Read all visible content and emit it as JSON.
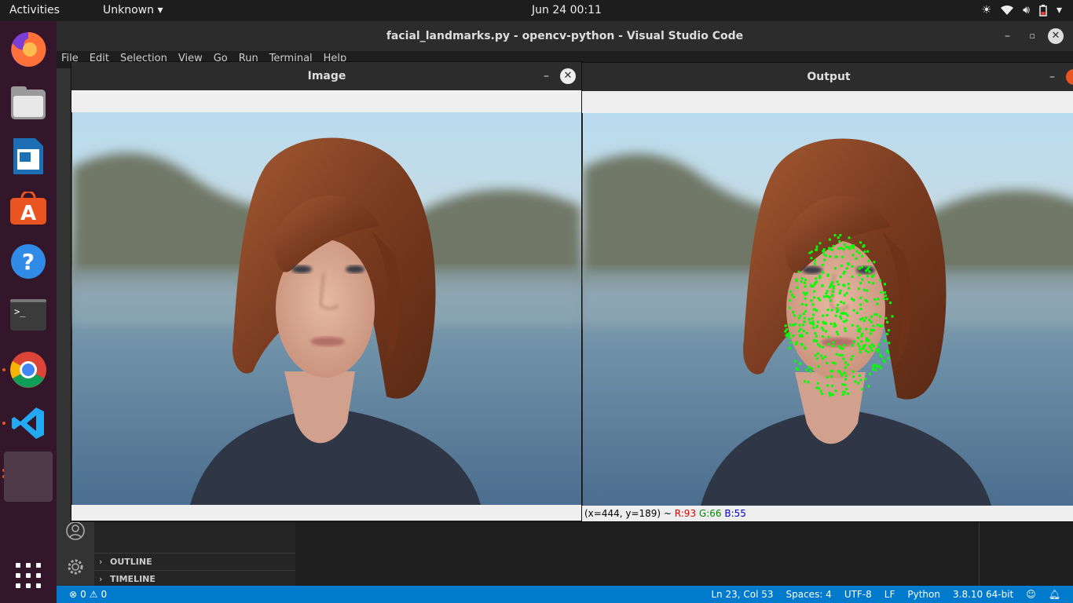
{
  "topbar": {
    "activities": "Activities",
    "app_menu": "Unknown",
    "clock": "Jun 24  00:11"
  },
  "dock": {
    "items": [
      {
        "name": "firefox-icon",
        "running": false
      },
      {
        "name": "files-icon",
        "running": false
      },
      {
        "name": "libreoffice-writer-icon",
        "running": false
      },
      {
        "name": "ubuntu-software-icon",
        "running": false
      },
      {
        "name": "help-icon",
        "running": false
      },
      {
        "name": "terminal-icon",
        "running": false
      },
      {
        "name": "chrome-icon",
        "running": true
      },
      {
        "name": "vscode-icon",
        "running": true
      },
      {
        "name": "opencv-windows-icon",
        "running": true
      }
    ]
  },
  "vscode": {
    "title": "facial_landmarks.py - opencv-python - Visual Studio Code",
    "menu": [
      "File",
      "Edit",
      "Selection",
      "View",
      "Go",
      "Run",
      "Terminal",
      "Help"
    ],
    "sidebar_sections": [
      "OUTLINE",
      "TIMELINE"
    ],
    "status": {
      "errors": "0",
      "warnings": "0",
      "position": "Ln 23, Col 53",
      "spaces": "Spaces: 4",
      "encoding": "UTF-8",
      "eol": "LF",
      "language": "Python",
      "interpreter": "3.8.10 64-bit"
    }
  },
  "image_window": {
    "title": "Image"
  },
  "output_window": {
    "title": "Output",
    "status": {
      "coords": "(x=444, y=189) ~ ",
      "r": "R:93",
      "g": "G:66",
      "b": "B:55"
    }
  },
  "colors": {
    "accent": "#007acc",
    "dock_bg": "#34162b",
    "landmark": "#00ff00"
  }
}
